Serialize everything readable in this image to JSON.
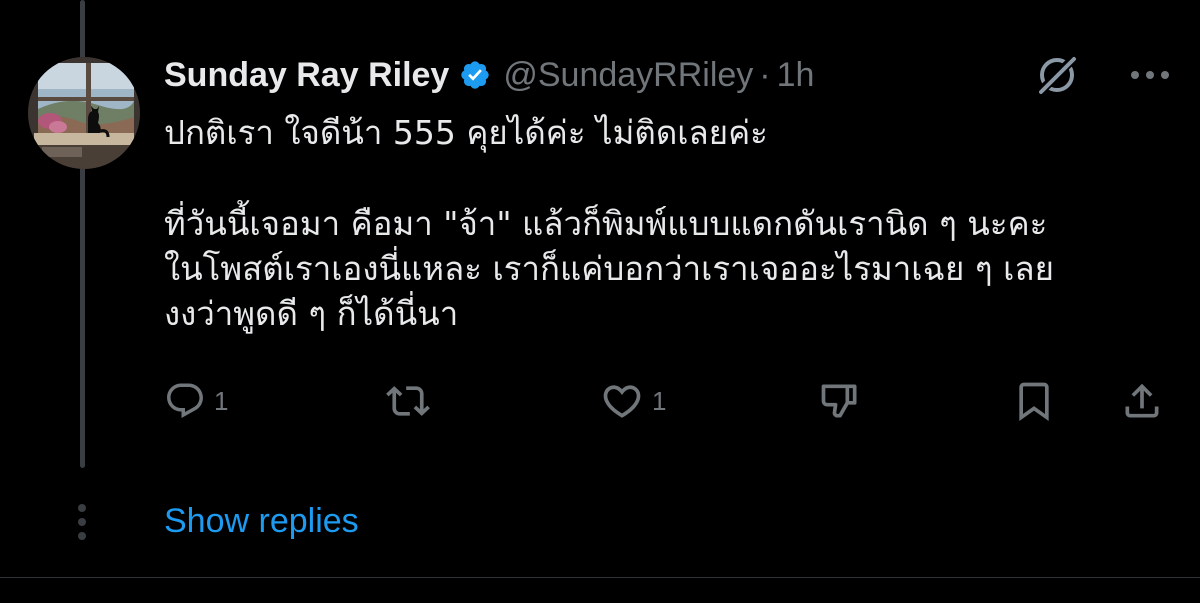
{
  "tweet": {
    "author": {
      "name": "Sunday Ray Riley",
      "handle": "@SundayRRiley",
      "verified": true,
      "avatar_icon": "avatar-cat-window"
    },
    "separator": "·",
    "time": "1h",
    "text": {
      "line1": "ปกติเรา ใจดีน้า 555 คุยได้ค่ะ ไม่ติดเลยค่ะ",
      "line2": "ที่วันนี้เจอมา คือมา \"จ้า\" แล้วก็พิมพ์แบบแดกดันเรานิด ๆ นะคะ",
      "line3": "ในโพสต์เราเองนี่แหละ เราก็แค่บอกว่าเราเจออะไรมาเฉย ๆ เลย",
      "line4": "งงว่าพูดดี ๆ ก็ได้นี่นา"
    },
    "actions": {
      "reply_count": "1",
      "retweet_count": "",
      "like_count": "1"
    },
    "show_replies_label": "Show replies"
  },
  "colors": {
    "background": "#000000",
    "text": "#e7e9ea",
    "muted": "#71767b",
    "accent": "#1d9bf0",
    "thread_line": "#3a3d41"
  }
}
